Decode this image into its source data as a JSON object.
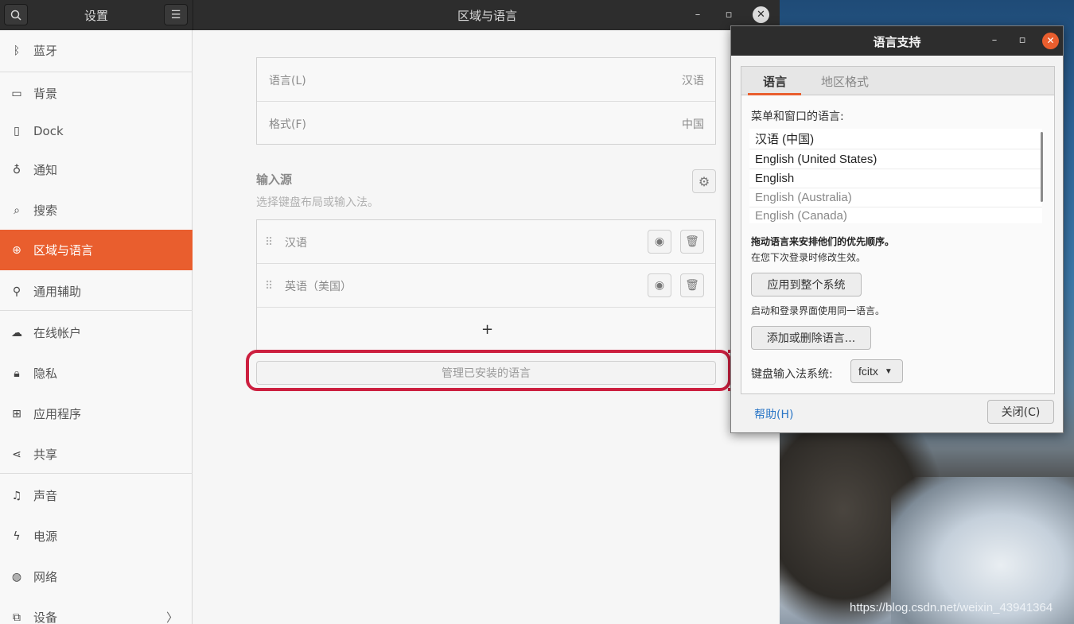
{
  "colors": {
    "accent": "#e95e2e",
    "highlight": "#cc1f3f",
    "link": "#2a76c6",
    "headerbar": "#2d2d2d"
  },
  "settings_window": {
    "sidebar_title": "设置",
    "page_title": "区域与语言",
    "search_icon": "search-icon",
    "menu_icon": "hamburger-menu-icon",
    "sidebar": [
      {
        "label": "蓝牙",
        "icon": "bluetooth-icon"
      },
      {
        "label": "背景",
        "icon": "background-icon"
      },
      {
        "label": "Dock",
        "icon": "dock-icon"
      },
      {
        "label": "通知",
        "icon": "bell-icon"
      },
      {
        "label": "搜索",
        "icon": "search-icon"
      },
      {
        "label": "区域与语言",
        "icon": "globe-icon",
        "active": true
      },
      {
        "label": "通用辅助",
        "icon": "accessibility-icon"
      },
      {
        "label": "在线帐户",
        "icon": "cloud-icon"
      },
      {
        "label": "隐私",
        "icon": "lock-icon"
      },
      {
        "label": "应用程序",
        "icon": "apps-icon"
      },
      {
        "label": "共享",
        "icon": "share-icon"
      },
      {
        "label": "声音",
        "icon": "music-note-icon"
      },
      {
        "label": "电源",
        "icon": "power-icon"
      },
      {
        "label": "网络",
        "icon": "network-icon"
      },
      {
        "label": "设备",
        "icon": "devices-icon"
      }
    ],
    "language_row": {
      "label": "语言(L)",
      "value": "汉语"
    },
    "format_row": {
      "label": "格式(F)",
      "value": "中国"
    },
    "input_sources": {
      "title": "输入源",
      "subtitle": "选择键盘布局或输入法。",
      "items": [
        "汉语",
        "英语（美国）"
      ],
      "add_label": "+"
    },
    "manage_button": "管理已安装的语言"
  },
  "dialog": {
    "title": "语言支持",
    "tabs": [
      "语言",
      "地区格式"
    ],
    "menu_lang_label": "菜单和窗口的语言:",
    "languages": [
      {
        "name": "汉语 (中国)",
        "dim": false
      },
      {
        "name": "English (United States)",
        "dim": false
      },
      {
        "name": "English",
        "dim": false
      },
      {
        "name": "English (Australia)",
        "dim": true
      },
      {
        "name": "English (Canada)",
        "dim": true
      }
    ],
    "drag_note": "拖动语言来安排他们的优先顺序。",
    "next_login_note": "在您下次登录时修改生效。",
    "apply_button": "应用到整个系统",
    "same_lang_note": "启动和登录界面使用同一语言。",
    "add_remove_button": "添加或删除语言...",
    "im_label": "键盘输入法系统:",
    "im_value": "fcitx",
    "help_button": "帮助(H)",
    "close_button": "关闭(C)"
  },
  "watermark": "https://blog.csdn.net/weixin_43941364"
}
